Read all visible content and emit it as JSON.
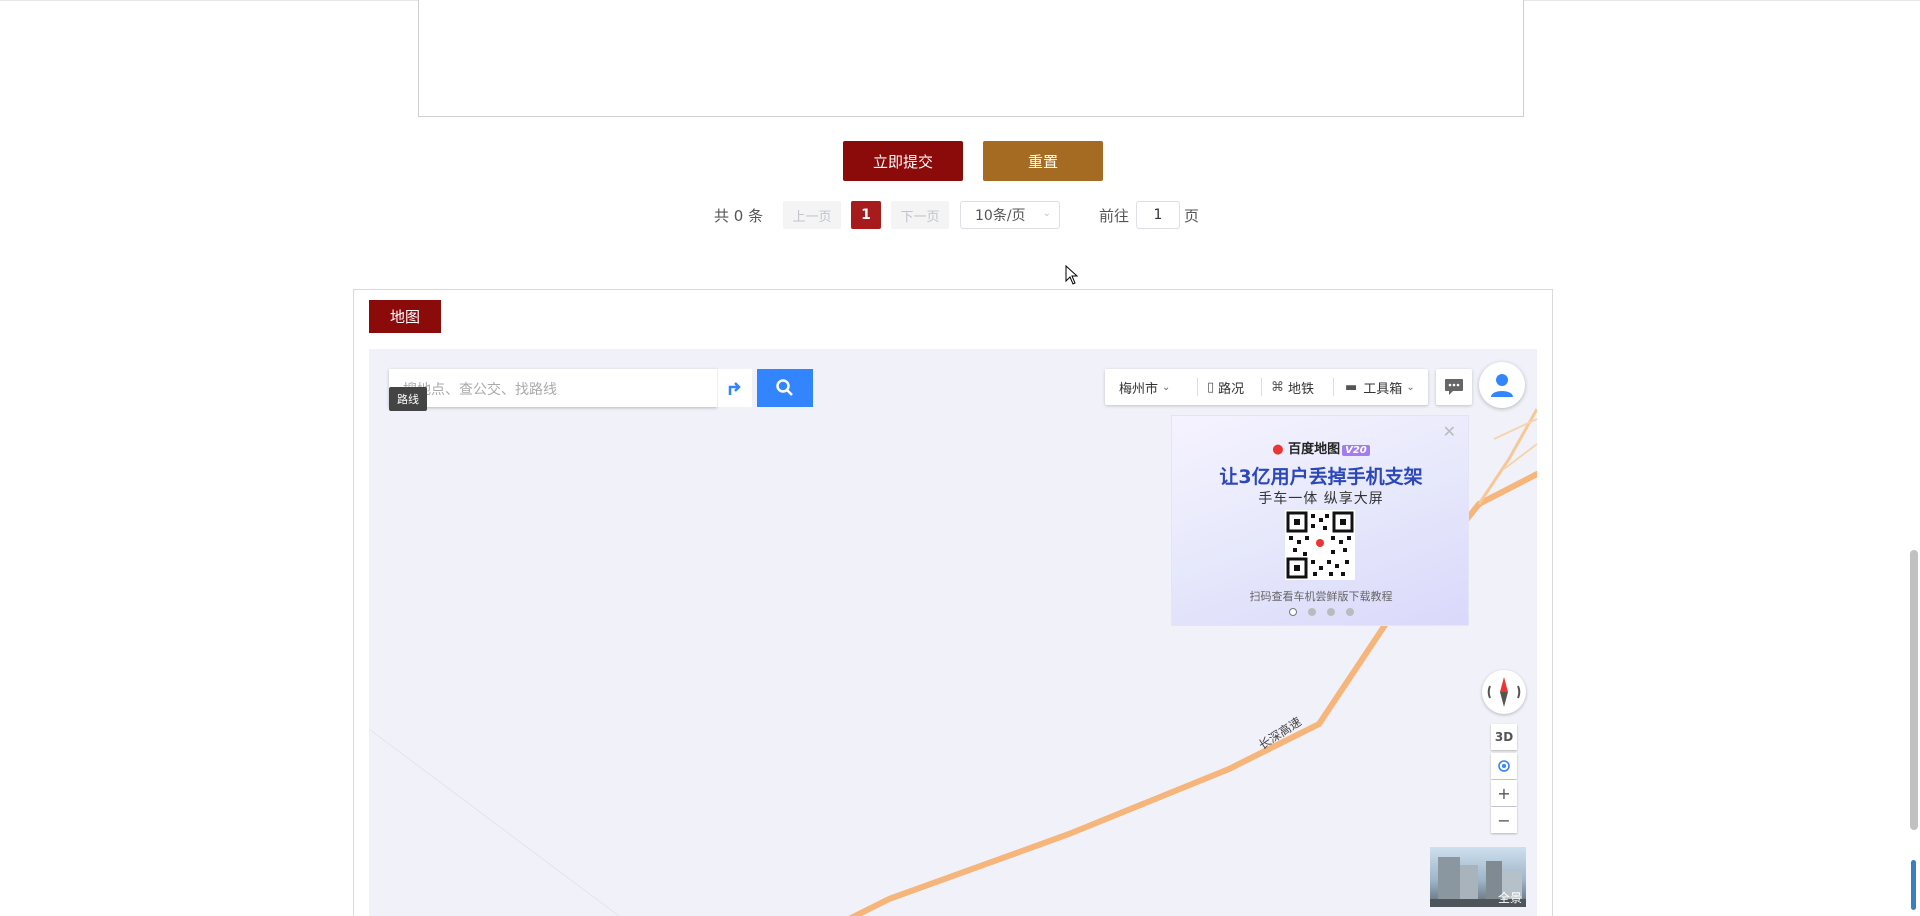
{
  "form": {
    "submit_label": "立即提交",
    "reset_label": "重置"
  },
  "pagination": {
    "total_text": "共 0 条",
    "prev_label": "上一页",
    "current_page": "1",
    "next_label": "下一页",
    "page_size": "10条/页",
    "goto_label": "前往",
    "goto_value": "1",
    "page_unit": "页"
  },
  "map_section": {
    "tab_label": "地图",
    "search_placeholder": "搜地点、查公交、找路线",
    "route_tooltip": "路线",
    "toolbar": {
      "city": "梅州市",
      "traffic": "路况",
      "subway": "地铁",
      "tools": "工具箱"
    },
    "promo": {
      "brand": "百度地图",
      "version": "V20",
      "headline": "让3亿用户丢掉手机支架",
      "subline": "手车一体 纵享大屏",
      "caption": "扫码查看车机尝鲜版下载教程"
    },
    "road_label": "长深高速",
    "controls": {
      "3d_label": "3D",
      "zoom_in": "+",
      "zoom_out": "−"
    },
    "panorama_label": "全景"
  },
  "colors": {
    "submit": "#8b0a0a",
    "reset": "#a56b22",
    "active_page": "#a61c1c",
    "road": "#f6b57a",
    "search_button": "#3385ff"
  },
  "icons": [
    "route-icon",
    "search-icon",
    "traffic-icon",
    "subway-icon",
    "toolbox-icon",
    "message-icon",
    "user-icon",
    "compass-icon",
    "locate-icon",
    "close-icon",
    "cursor-icon"
  ]
}
